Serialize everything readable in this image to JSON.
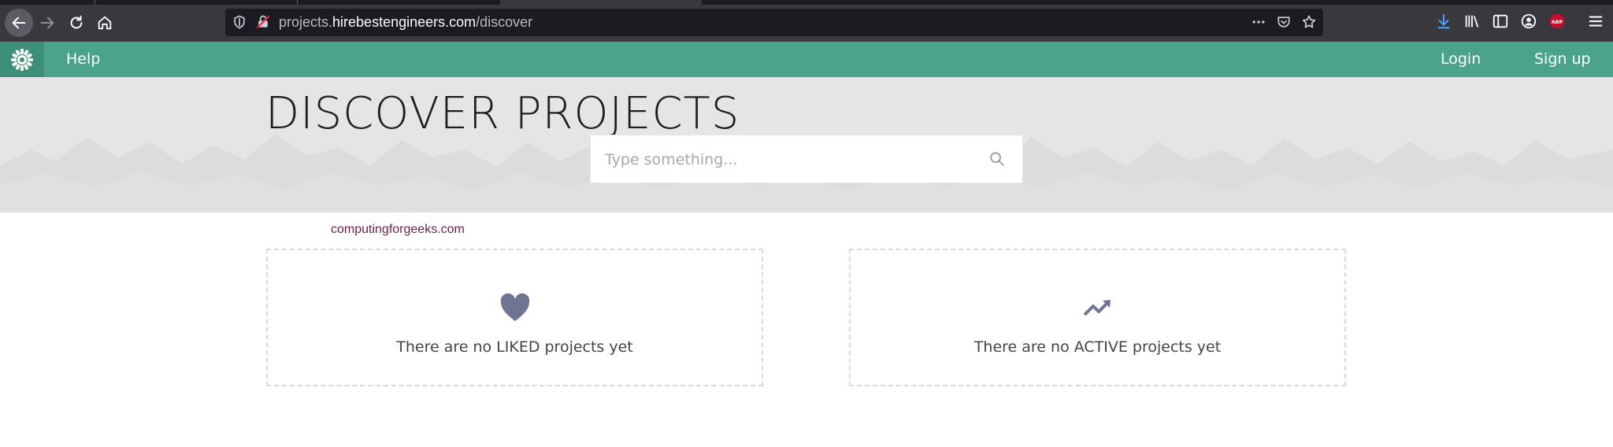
{
  "browser": {
    "url_prefix": "projects.",
    "url_domain": "hirebestengineers.com",
    "url_path": "/discover"
  },
  "nav": {
    "help_label": "Help",
    "login_label": "Login",
    "signup_label": "Sign up"
  },
  "hero": {
    "title": "DISCOVER PROJECTS",
    "search_placeholder": "Type something..."
  },
  "watermark": "computingforgeeks.com",
  "cards": {
    "liked_text": "There are no LIKED projects yet",
    "active_text": "There are no ACTIVE projects yet"
  },
  "colors": {
    "navbar": "#4aa48a",
    "hero_bg": "#e5e5e8",
    "card_icon": "#6f7591",
    "watermark": "#6b1f4a"
  }
}
